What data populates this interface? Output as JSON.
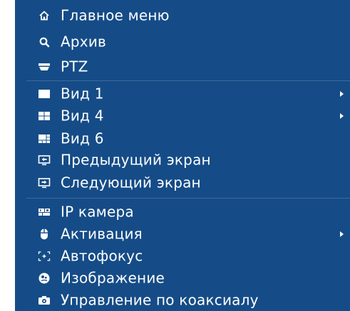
{
  "menu": {
    "items": [
      {
        "label": "Главное меню",
        "icon": "home-icon"
      },
      {
        "label": "Архив",
        "icon": "search-icon"
      },
      {
        "label": "PTZ",
        "icon": "ptz-camera-icon"
      },
      {
        "label": "Вид 1",
        "icon": "view-1-icon",
        "submenu": true
      },
      {
        "label": "Вид 4",
        "icon": "view-4-icon",
        "submenu": true
      },
      {
        "label": "Вид 6",
        "icon": "view-6-icon"
      },
      {
        "label": "Предыдущий экран",
        "icon": "previous-screen-icon"
      },
      {
        "label": "Следующий экран",
        "icon": "next-screen-icon"
      },
      {
        "label": "IP камера",
        "icon": "ip-camera-icon"
      },
      {
        "label": "Активация",
        "icon": "mouse-icon",
        "submenu": true
      },
      {
        "label": "Автофокус",
        "icon": "autofocus-icon"
      },
      {
        "label": "Изображение",
        "icon": "image-settings-icon"
      },
      {
        "label": "Управление по коаксиалу",
        "icon": "coaxial-camera-icon"
      }
    ]
  },
  "colors": {
    "background": "#154c87",
    "divider": "#3b6a9e",
    "text": "#ffffff"
  }
}
